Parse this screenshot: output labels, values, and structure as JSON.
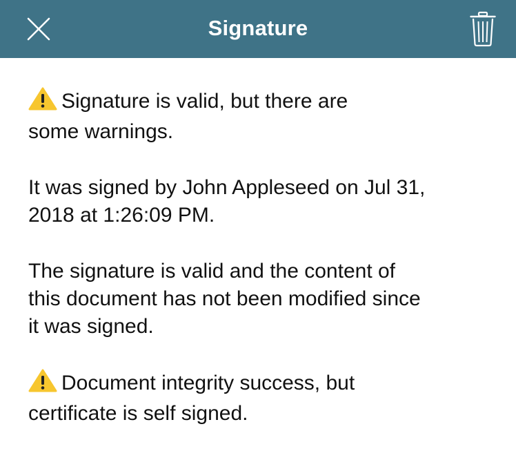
{
  "colors": {
    "nav_background": "#3f7387",
    "nav_foreground": "#ffffff",
    "warning": "#f7c62f"
  },
  "header": {
    "title": "Signature",
    "left_icon": "close-icon",
    "right_icon": "trash-icon"
  },
  "messages": {
    "summary": {
      "icon": "warning-icon",
      "line1": "Signature is valid, but there are",
      "line2": "some warnings."
    },
    "signer": {
      "line1": "It was signed by John Appleseed on Jul 31,",
      "line2": "2018 at 1:26:09 PM."
    },
    "validity": {
      "line1": "The signature is valid and the content of",
      "line2": "this document has not been modified since",
      "line3": "it was signed."
    },
    "integrity": {
      "icon": "warning-icon",
      "line1": "Document integrity success, but",
      "line2": "certificate is self signed."
    }
  }
}
